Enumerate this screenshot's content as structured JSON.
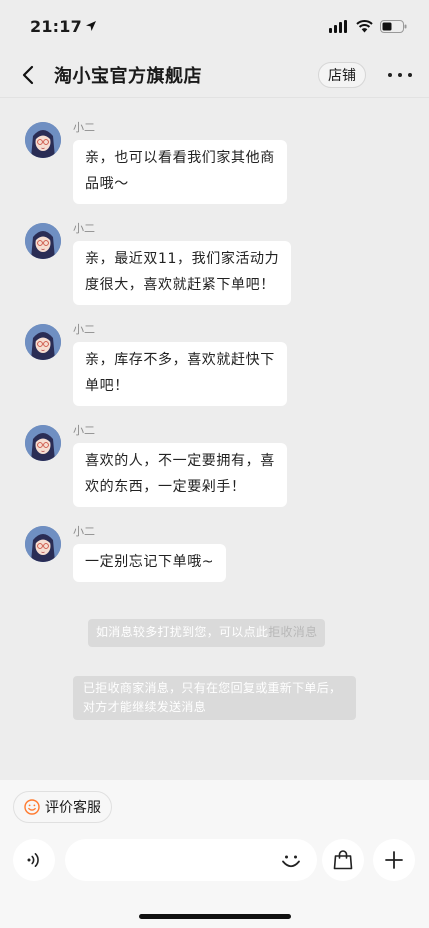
{
  "status_bar": {
    "time": "21:17"
  },
  "header": {
    "title": "淘小宝官方旗舰店",
    "shop_label": "店铺"
  },
  "messages": [
    {
      "sender": "小二",
      "lines": [
        "亲，也可以看看我们家其他商",
        "品哦～"
      ]
    },
    {
      "sender": "小二",
      "lines": [
        "亲，最近双11，我们家活动力",
        "度很大，喜欢就赶紧下单吧！"
      ]
    },
    {
      "sender": "小二",
      "lines": [
        "亲，库存不多，喜欢就赶快下",
        "单吧！"
      ]
    },
    {
      "sender": "小二",
      "lines": [
        "喜欢的人，不一定要拥有，喜",
        "欢的东西，一定要剁手！"
      ]
    },
    {
      "sender": "小二",
      "lines": [
        "一定别忘记下单哦~"
      ]
    }
  ],
  "notices": {
    "disturb_text": "如消息较多打扰到您，可以点此",
    "reject_link": "拒收消息",
    "rejected_line1": "已拒收商家消息，只有在您回复或重新下单后，",
    "rejected_line2": "对方才能继续发送消息"
  },
  "bottom": {
    "rate_label": "评价客服",
    "input_value": "",
    "input_placeholder": ""
  },
  "icons": {
    "back": "chevron-left-icon",
    "more": "more-dots-icon",
    "voice": "voice-icon",
    "emoji": "emoji-icon",
    "bag": "shopping-bag-icon",
    "plus": "plus-icon",
    "smile_orange": "smile-icon"
  },
  "colors": {
    "accent": "#ff7a2f",
    "background": "#ededed",
    "bubble": "#ffffff"
  }
}
